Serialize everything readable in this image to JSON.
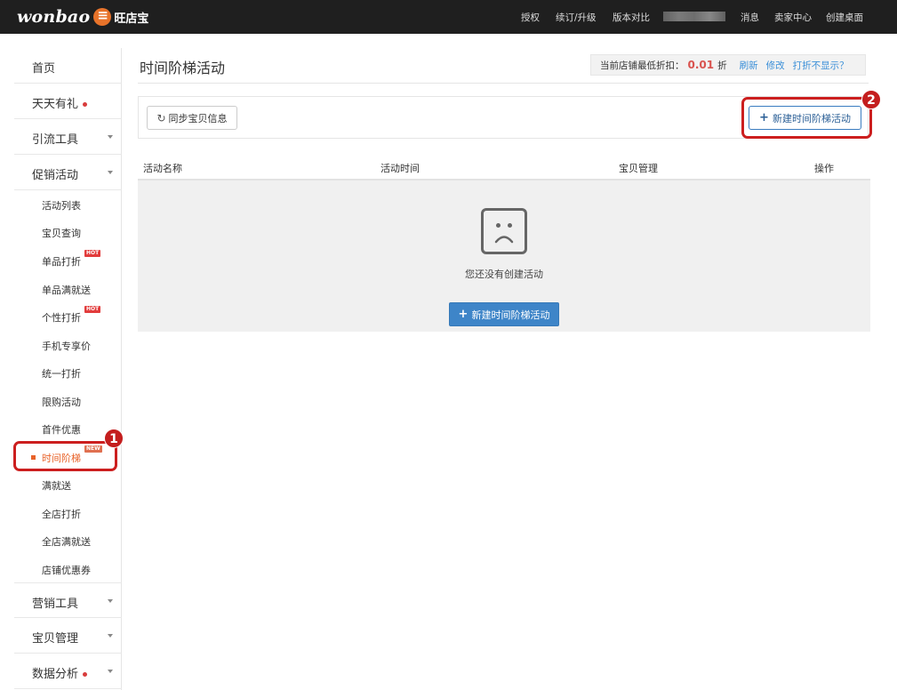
{
  "brand": {
    "name": "wonbao",
    "cn_name": "旺店宝"
  },
  "topnav": {
    "authorize": "授权",
    "renew": "续订/升级",
    "compare": "版本对比",
    "messages": "消息",
    "seller_center": "卖家中心",
    "create_desktop": "创建桌面"
  },
  "sidebar": {
    "home": "首页",
    "daily_gift": "天天有礼",
    "traffic_tools": "引流工具",
    "promotions": "促销活动",
    "sub": {
      "activity_list": "活动列表",
      "item_query": "宝贝查询",
      "single_discount": "单品打折",
      "single_full_gift": "单品满就送",
      "personal_discount": "个性打折",
      "mobile_price": "手机专享价",
      "unified_discount": "统一打折",
      "purchase_limit": "限购活动",
      "first_item": "首件优惠",
      "time_ladder": "时间阶梯",
      "full_gift": "满就送",
      "store_discount": "全店打折",
      "store_full_gift": "全店满就送",
      "store_coupon": "店铺优惠券"
    },
    "marketing_tools": "营销工具",
    "item_management": "宝贝管理",
    "data_analysis": "数据分析",
    "tags": {
      "hot": "HOT",
      "new": "NEW"
    }
  },
  "annotations": {
    "one": "1",
    "two": "2"
  },
  "main": {
    "page_title": "时间阶梯活动",
    "discount": {
      "label": "当前店铺最低折扣：",
      "value": "0.01",
      "unit": "折",
      "refresh": "刷新",
      "edit": "修改",
      "hide": "打折不显示？"
    },
    "sync_button": "同步宝贝信息",
    "new_button": "新建时间阶梯活动",
    "table": {
      "headers": [
        "活动名称",
        "活动时间",
        "宝贝管理",
        "操作"
      ]
    },
    "empty_text": "您还没有创建活动",
    "empty_new_button": "新建时间阶梯活动"
  },
  "colors": {
    "accent": "#3e85c8",
    "highlight": "#cc1f1f",
    "active": "#e8632a"
  }
}
